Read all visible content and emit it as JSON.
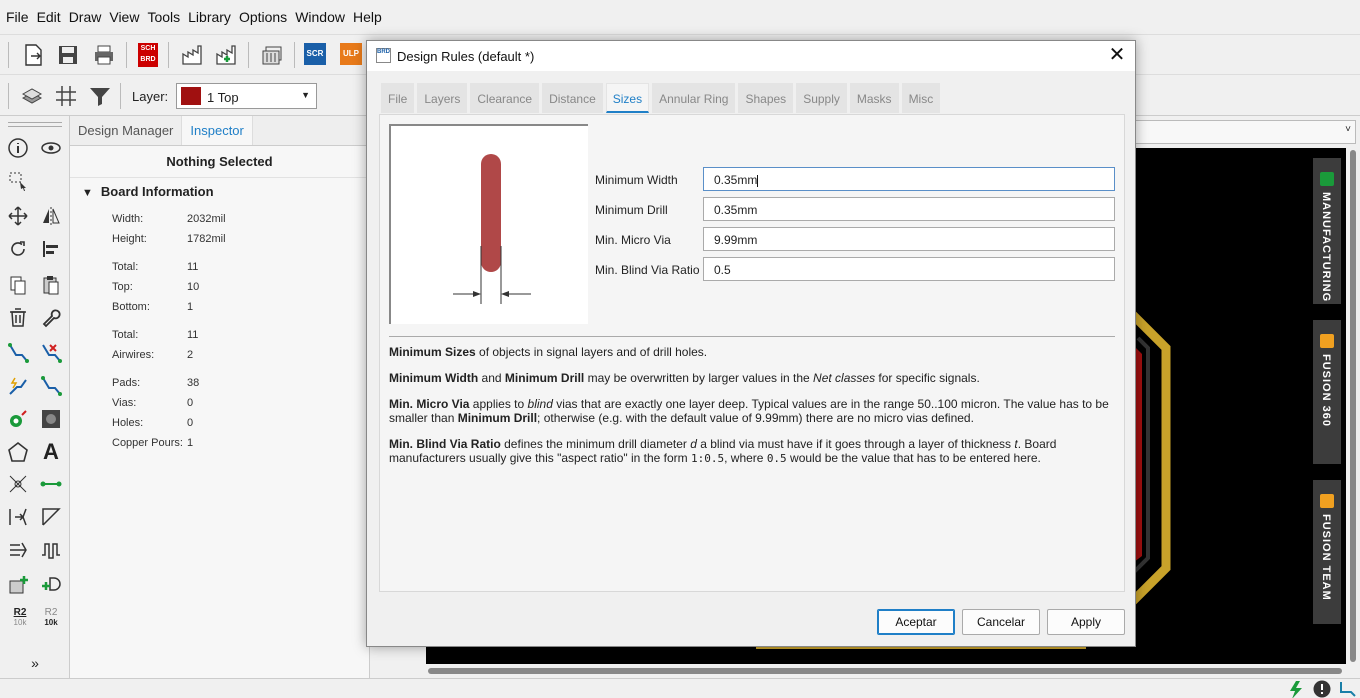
{
  "menu": [
    "File",
    "Edit",
    "Draw",
    "View",
    "Tools",
    "Library",
    "Options",
    "Window",
    "Help"
  ],
  "toolbar": {
    "layer_label": "Layer:",
    "layer_value": "1 Top",
    "layer_color": "#a01010",
    "sch_label": "SCH",
    "brd_label": "BRD",
    "scr_label": "SCR",
    "ulp_label": "ULP"
  },
  "inspector": {
    "tabs": [
      "Design Manager",
      "Inspector"
    ],
    "active_tab": "Inspector",
    "selection_title": "Nothing Selected",
    "section_title": "Board Information",
    "rows": [
      {
        "k": "Width:",
        "v": "2032mil"
      },
      {
        "k": "Height:",
        "v": "1782mil"
      },
      {
        "k": "Total:",
        "v": "11"
      },
      {
        "k": "Top:",
        "v": "10"
      },
      {
        "k": "Bottom:",
        "v": "1"
      },
      {
        "k": "Total:",
        "v": "11"
      },
      {
        "k": "Airwires:",
        "v": "2"
      },
      {
        "k": "Pads:",
        "v": "38"
      },
      {
        "k": "Vias:",
        "v": "0"
      },
      {
        "k": "Holes:",
        "v": "0"
      },
      {
        "k": "Copper Pours:",
        "v": "1"
      }
    ]
  },
  "left_tools": {
    "r2_label": "R2",
    "val_label": "10k"
  },
  "side_tabs": [
    "MANUFACTURING",
    "FUSION 360",
    "FUSION TEAM"
  ],
  "dialog": {
    "title": "Design Rules (default *)",
    "icon_text": "BRD",
    "tabs": [
      "File",
      "Layers",
      "Clearance",
      "Distance",
      "Sizes",
      "Annular Ring",
      "Shapes",
      "Supply",
      "Masks",
      "Misc"
    ],
    "active_tab": "Sizes",
    "fields": [
      {
        "label": "Minimum Width",
        "value": "0.35mm"
      },
      {
        "label": "Minimum Drill",
        "value": "0.35mm"
      },
      {
        "label": "Min. Micro Via",
        "value": "9.99mm"
      },
      {
        "label": "Min. Blind Via Ratio",
        "value": "0.5"
      }
    ],
    "help": {
      "p1_b": "Minimum Sizes",
      "p1": " of objects in signal layers and of drill holes.",
      "p2_b1": "Minimum Width",
      "p2_a": " and ",
      "p2_b2": "Minimum Drill",
      "p2_c": " may be overwritten by larger values in the ",
      "p2_i": "Net classes",
      "p2_d": " for specific signals.",
      "p3_b1": "Min. Micro Via",
      "p3_a": " applies to ",
      "p3_i": "blind",
      "p3_c": " vias that are exactly one layer deep. Typical values are in the range 50..100 micron. The value has to be smaller than ",
      "p3_b2": "Minimum Drill",
      "p3_d": "; otherwise (e.g. with the default value of 9.99mm) there are no micro vias defined.",
      "p4_b": "Min. Blind Via Ratio",
      "p4_a": " defines the minimum drill diameter ",
      "p4_i1": "d",
      "p4_c": " a blind via must have if it goes through a layer of thickness ",
      "p4_i2": "t",
      "p4_d": ". Board manufacturers usually give this \"aspect ratio\" in the form ",
      "p4_m1": "1:0.5",
      "p4_e": ", where ",
      "p4_m2": "0.5",
      "p4_f": " would be the value that has to be entered here."
    },
    "buttons": {
      "ok": "Aceptar",
      "cancel": "Cancelar",
      "apply": "Apply"
    }
  },
  "colors": {
    "accent": "#1f7fc7",
    "board_bg": "#000000",
    "board_outline": "#c8a22a",
    "copper": "#a00f0f",
    "trace_preview": "#b04848"
  }
}
